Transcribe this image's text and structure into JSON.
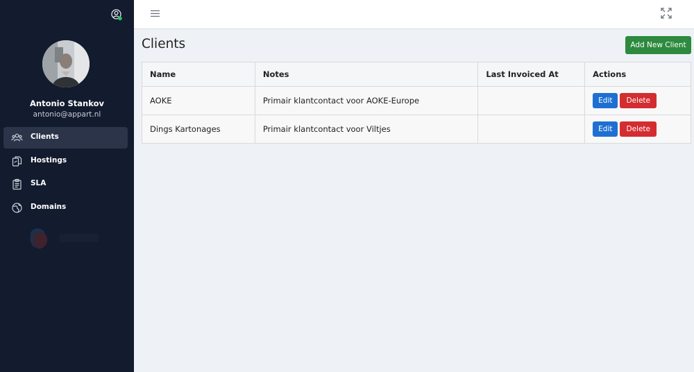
{
  "sidebar": {
    "user": {
      "name": "Antonio Stankov",
      "email": "antonio@appart.nl",
      "status_color": "#22c55e"
    },
    "items": [
      {
        "label": "Clients",
        "icon": "users-icon",
        "active": true
      },
      {
        "label": "Hostings",
        "icon": "documents-icon",
        "active": false
      },
      {
        "label": "SLA",
        "icon": "clipboard-icon",
        "active": false
      },
      {
        "label": "Domains",
        "icon": "globe-icon",
        "active": false
      }
    ]
  },
  "topbar": {
    "menu_icon": "hamburger-icon",
    "fullscreen_icon": "fullscreen-icon"
  },
  "main": {
    "title": "Clients",
    "add_button_label": "Add New Client",
    "table": {
      "headers": [
        "Name",
        "Notes",
        "Last Invoiced At",
        "Actions"
      ],
      "rows": [
        {
          "name": "AOKE",
          "notes": "Primair klantcontact voor AOKE-Europe",
          "last_invoiced": "",
          "edit_label": "Edit",
          "delete_label": "Delete"
        },
        {
          "name": "Dings Kartonages",
          "notes": "Primair klantcontact voor Viltjes",
          "last_invoiced": "",
          "edit_label": "Edit",
          "delete_label": "Delete"
        }
      ]
    }
  },
  "colors": {
    "sidebar_bg": "#131b2e",
    "active_item_bg": "#2b3448",
    "add_button": "#2d8a3e",
    "edit_button": "#1f6fd2",
    "delete_button": "#d42c30"
  }
}
